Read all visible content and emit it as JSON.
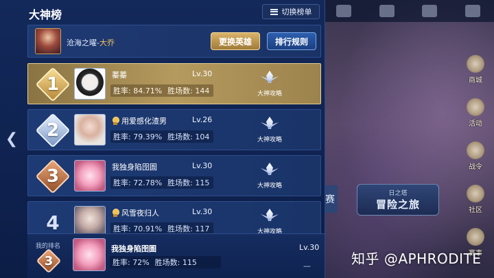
{
  "panel": {
    "title": "大神榜",
    "switch_label": "切换榜单"
  },
  "hero": {
    "name_prefix": "沧海之曜-",
    "name_highlight": "大乔",
    "change_label": "更换英雄",
    "rules_label": "排行规则"
  },
  "guide_label": "大神攻略",
  "ranks": [
    {
      "rank": "1",
      "name": "蓁蓁",
      "level": "Lv.30",
      "winrate": "胜率: 84.71%",
      "matches": "胜场数: 144"
    },
    {
      "rank": "2",
      "name": "用爱感化渣男",
      "level": "Lv.26",
      "winrate": "胜率: 79.39%",
      "matches": "胜场数: 104"
    },
    {
      "rank": "3",
      "name": "我独身陷囹圄",
      "level": "Lv.30",
      "winrate": "胜率: 72.78%",
      "matches": "胜场数: 115"
    },
    {
      "rank": "4",
      "name": "风雪夜归人",
      "level": "Lv.30",
      "winrate": "胜率: 70.91%",
      "matches": "胜场数: 117"
    }
  ],
  "my_rank": {
    "label": "我的排名",
    "rank": "3",
    "name": "我独身陷囹圄",
    "level": "Lv.30",
    "winrate": "胜率: 72%",
    "matches": "胜场数: 115",
    "extra": "—"
  },
  "scene": {
    "side_menu": [
      "商城",
      "活动",
      "战令",
      "社区",
      "赛事"
    ],
    "banner_small": "日之塔",
    "banner_big": "冒险之旅",
    "banner_left": "赛"
  },
  "watermark": "知乎 @APHRODITE",
  "colors": {
    "panel_bg": "#13295a",
    "gold_row": "#b59a5e",
    "accent_gold": "#f0c35a",
    "rules_btn": "#2c5fae"
  }
}
